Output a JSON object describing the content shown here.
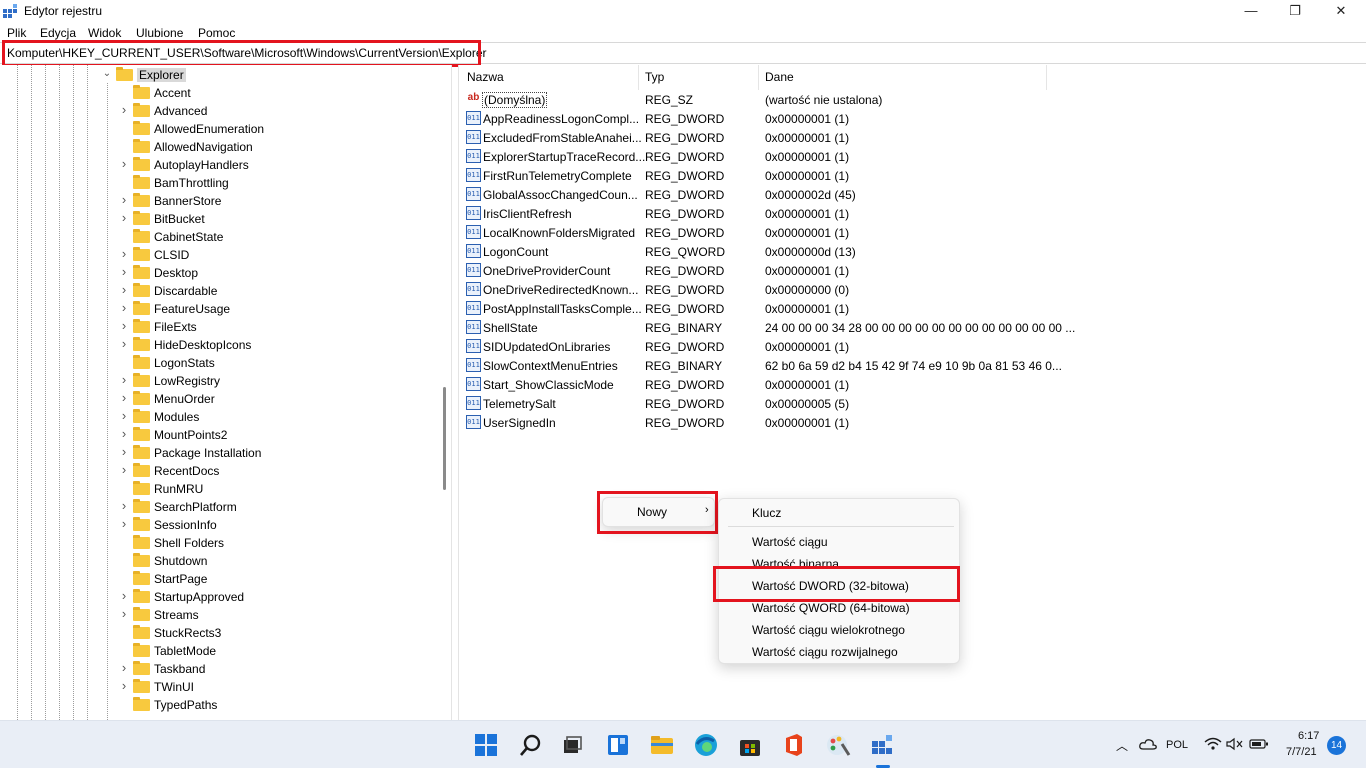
{
  "window": {
    "title": "Edytor rejestru",
    "minimize": "—",
    "maximize": "❐",
    "close": "✕"
  },
  "menu": [
    "Plik",
    "Edycja",
    "Widok",
    "Ulubione",
    "Pomoc"
  ],
  "address": "Komputer\\HKEY_CURRENT_USER\\Software\\Microsoft\\Windows\\CurrentVersion\\Explorer",
  "tree": {
    "selected": "Explorer",
    "children": [
      {
        "label": "Accent",
        "expandable": false
      },
      {
        "label": "Advanced",
        "expandable": true
      },
      {
        "label": "AllowedEnumeration",
        "expandable": false
      },
      {
        "label": "AllowedNavigation",
        "expandable": false
      },
      {
        "label": "AutoplayHandlers",
        "expandable": true
      },
      {
        "label": "BamThrottling",
        "expandable": false
      },
      {
        "label": "BannerStore",
        "expandable": true
      },
      {
        "label": "BitBucket",
        "expandable": true
      },
      {
        "label": "CabinetState",
        "expandable": false
      },
      {
        "label": "CLSID",
        "expandable": true
      },
      {
        "label": "Desktop",
        "expandable": true
      },
      {
        "label": "Discardable",
        "expandable": true
      },
      {
        "label": "FeatureUsage",
        "expandable": true
      },
      {
        "label": "FileExts",
        "expandable": true
      },
      {
        "label": "HideDesktopIcons",
        "expandable": true
      },
      {
        "label": "LogonStats",
        "expandable": false
      },
      {
        "label": "LowRegistry",
        "expandable": true
      },
      {
        "label": "MenuOrder",
        "expandable": true
      },
      {
        "label": "Modules",
        "expandable": true
      },
      {
        "label": "MountPoints2",
        "expandable": true
      },
      {
        "label": "Package Installation",
        "expandable": true
      },
      {
        "label": "RecentDocs",
        "expandable": true
      },
      {
        "label": "RunMRU",
        "expandable": false
      },
      {
        "label": "SearchPlatform",
        "expandable": true
      },
      {
        "label": "SessionInfo",
        "expandable": true
      },
      {
        "label": "Shell Folders",
        "expandable": false
      },
      {
        "label": "Shutdown",
        "expandable": false
      },
      {
        "label": "StartPage",
        "expandable": false
      },
      {
        "label": "StartupApproved",
        "expandable": true
      },
      {
        "label": "Streams",
        "expandable": true
      },
      {
        "label": "StuckRects3",
        "expandable": false
      },
      {
        "label": "TabletMode",
        "expandable": false
      },
      {
        "label": "Taskband",
        "expandable": true
      },
      {
        "label": "TWinUI",
        "expandable": true
      },
      {
        "label": "TypedPaths",
        "expandable": false
      }
    ]
  },
  "columns": {
    "name": "Nazwa",
    "type": "Typ",
    "data": "Dane"
  },
  "values": [
    {
      "name": "(Domyślna)",
      "type": "REG_SZ",
      "data": "(wartość nie ustalona)",
      "icon": "string-value-icon"
    },
    {
      "name": "AppReadinessLogonCompl...",
      "type": "REG_DWORD",
      "data": "0x00000001 (1)",
      "icon": "binary-value-icon"
    },
    {
      "name": "ExcludedFromStableAnahei...",
      "type": "REG_DWORD",
      "data": "0x00000001 (1)",
      "icon": "binary-value-icon"
    },
    {
      "name": "ExplorerStartupTraceRecord...",
      "type": "REG_DWORD",
      "data": "0x00000001 (1)",
      "icon": "binary-value-icon"
    },
    {
      "name": "FirstRunTelemetryComplete",
      "type": "REG_DWORD",
      "data": "0x00000001 (1)",
      "icon": "binary-value-icon"
    },
    {
      "name": "GlobalAssocChangedCoun...",
      "type": "REG_DWORD",
      "data": "0x0000002d (45)",
      "icon": "binary-value-icon"
    },
    {
      "name": "IrisClientRefresh",
      "type": "REG_DWORD",
      "data": "0x00000001 (1)",
      "icon": "binary-value-icon"
    },
    {
      "name": "LocalKnownFoldersMigrated",
      "type": "REG_DWORD",
      "data": "0x00000001 (1)",
      "icon": "binary-value-icon"
    },
    {
      "name": "LogonCount",
      "type": "REG_QWORD",
      "data": "0x0000000d (13)",
      "icon": "binary-value-icon"
    },
    {
      "name": "OneDriveProviderCount",
      "type": "REG_DWORD",
      "data": "0x00000001 (1)",
      "icon": "binary-value-icon"
    },
    {
      "name": "OneDriveRedirectedKnown...",
      "type": "REG_DWORD",
      "data": "0x00000000 (0)",
      "icon": "binary-value-icon"
    },
    {
      "name": "PostAppInstallTasksComple...",
      "type": "REG_DWORD",
      "data": "0x00000001 (1)",
      "icon": "binary-value-icon"
    },
    {
      "name": "ShellState",
      "type": "REG_BINARY",
      "data": "24 00 00 00 34 28 00 00 00 00 00 00 00 00 00 00 00 00 ...",
      "icon": "binary-value-icon"
    },
    {
      "name": "SIDUpdatedOnLibraries",
      "type": "REG_DWORD",
      "data": "0x00000001 (1)",
      "icon": "binary-value-icon"
    },
    {
      "name": "SlowContextMenuEntries",
      "type": "REG_BINARY",
      "data": "62 b0 6a 59 d2 b4 15 42 9f 74 e9 10 9b 0a 81 53 46 0...",
      "icon": "binary-value-icon"
    },
    {
      "name": "Start_ShowClassicMode",
      "type": "REG_DWORD",
      "data": "0x00000001 (1)",
      "icon": "binary-value-icon"
    },
    {
      "name": "TelemetrySalt",
      "type": "REG_DWORD",
      "data": "0x00000005 (5)",
      "icon": "binary-value-icon"
    },
    {
      "name": "UserSignedIn",
      "type": "REG_DWORD",
      "data": "0x00000001 (1)",
      "icon": "binary-value-icon"
    }
  ],
  "context_menu": {
    "new_label": "Nowy",
    "submenu": {
      "key": "Klucz",
      "string": "Wartość ciągu",
      "binary": "Wartość binarna",
      "dword": "Wartość DWORD (32-bitowa)",
      "qword": "Wartość QWORD (64-bitowa)",
      "multi_string": "Wartość ciągu wielokrotnego",
      "expandable_string": "Wartość ciągu rozwijalnego"
    }
  },
  "taskbar": {
    "language": "POL",
    "time": "6:17",
    "date": "7/7/21",
    "notifications": "14"
  },
  "colors": {
    "highlight": "#e3141e",
    "folder": "#f8c93e",
    "taskbar": "#e9eef6"
  }
}
